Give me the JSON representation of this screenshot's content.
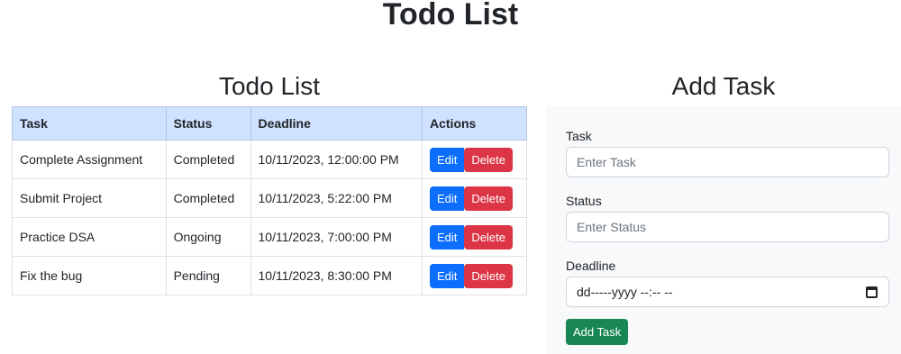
{
  "page": {
    "title": "Todo List"
  },
  "todo_section": {
    "title": "Todo List",
    "columns": [
      "Task",
      "Status",
      "Deadline",
      "Actions"
    ],
    "rows": [
      {
        "task": "Complete Assignment",
        "status": "Completed",
        "deadline": "10/11/2023, 12:00:00 PM"
      },
      {
        "task": "Submit Project",
        "status": "Completed",
        "deadline": "10/11/2023, 5:22:00 PM"
      },
      {
        "task": "Practice DSA",
        "status": "Ongoing",
        "deadline": "10/11/2023, 7:00:00 PM"
      },
      {
        "task": "Fix the bug",
        "status": "Pending",
        "deadline": "10/11/2023, 8:30:00 PM"
      }
    ],
    "edit_label": "Edit",
    "delete_label": "Delete"
  },
  "add_section": {
    "title": "Add Task",
    "task_label": "Task",
    "task_placeholder": "Enter Task",
    "status_label": "Status",
    "status_placeholder": "Enter Status",
    "deadline_label": "Deadline",
    "deadline_value": "dd-----yyyy --:-- --",
    "submit_label": "Add Task"
  },
  "colors": {
    "header_bg": "#cfe2ff",
    "edit_button": "#0d6efd",
    "delete_button": "#dc3545",
    "add_button": "#198754",
    "form_panel_bg": "#f8f9fa"
  },
  "icons": {
    "deadline_picker": "calendar-icon"
  }
}
